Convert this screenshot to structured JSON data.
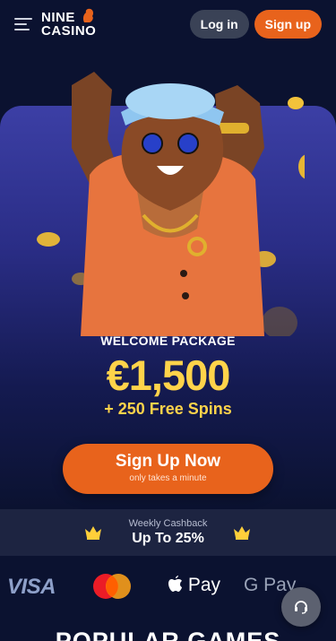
{
  "header": {
    "logo_line1": "NINE",
    "logo_line2": "CASINO",
    "login_label": "Log in",
    "signup_label": "Sign up"
  },
  "promo": {
    "label": "WELCOME PACKAGE",
    "amount": "€1,500",
    "spins": "+ 250 Free Spins"
  },
  "cta": {
    "title": "Sign Up Now",
    "subtitle": "only takes a minute"
  },
  "cashback": {
    "label": "Weekly Cashback",
    "value": "Up To 25%"
  },
  "payments": {
    "visa": "VISA",
    "apple_pay": "Pay",
    "google_pay": "G Pay"
  },
  "section": {
    "title": "POPULAR GAMES"
  },
  "colors": {
    "accent": "#e8631c",
    "gold": "#ffd34a",
    "background": "#0b1230"
  },
  "icons": [
    "menu-icon",
    "lion-logo-icon",
    "crown-icon",
    "mastercard-icon",
    "apple-icon",
    "support-headset-icon"
  ]
}
